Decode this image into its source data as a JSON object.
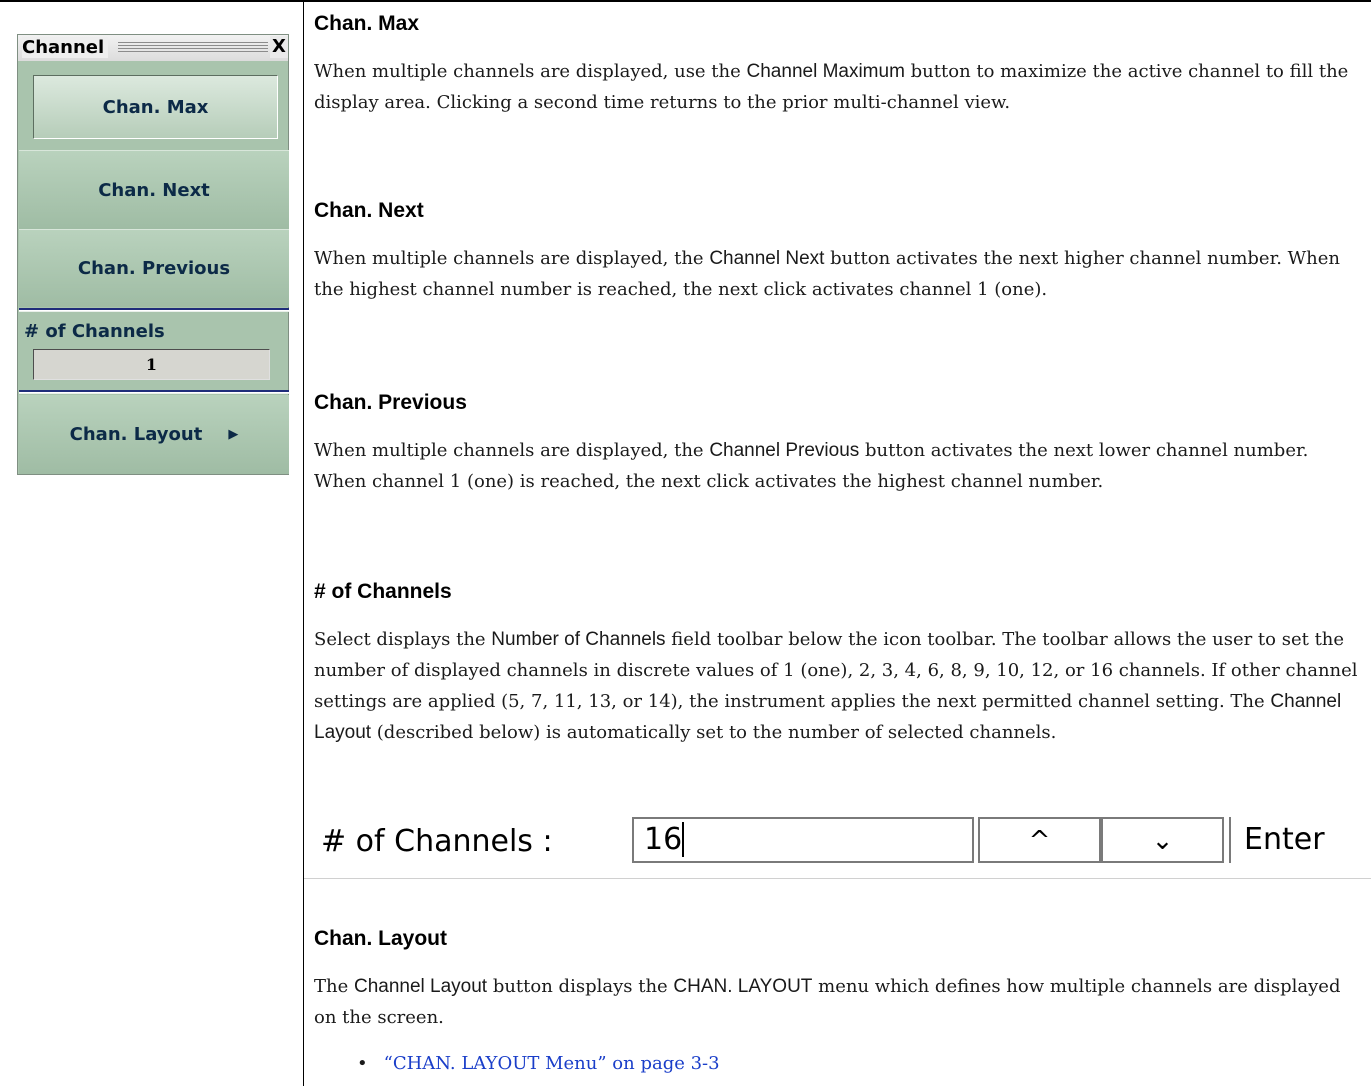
{
  "panel": {
    "title": "Channel",
    "close_label": "X",
    "buttons": {
      "chan_max": "Chan. Max",
      "chan_next": "Chan. Next",
      "chan_previous": "Chan. Previous",
      "chan_layout": "Chan. Layout"
    },
    "num_channels_label": "# of Channels",
    "num_channels_value": "1",
    "arrow_icon": "triangle-right-icon"
  },
  "doc": {
    "sections": [
      {
        "heading": "Chan. Max",
        "p1": "When multiple channels are displayed, use the ",
        "term": "Channel Maximum",
        "p2": " button to maximize the active channel to fill the display area. Clicking a second time returns to the prior multi-channel view."
      },
      {
        "heading": "Chan. Next",
        "p1": "When multiple channels are displayed, the ",
        "term": "Channel Next",
        "p2": " button activates the next higher channel number. When the highest channel number is reached, the next click activates channel 1 (one)."
      },
      {
        "heading": "Chan. Previous",
        "p1": "When multiple channels are displayed, the ",
        "term": "Channel Previous",
        "p2": " button activates the next lower channel number. When channel 1 (one) is reached, the next click activates the highest channel number."
      },
      {
        "heading": "# of Channels",
        "p1": "Select displays the ",
        "term": "Number of Channels",
        "p2": " field toolbar below the icon toolbar. The toolbar allows the user to set the number of displayed channels in discrete values of 1 (one), 2, 3, 4, 6, 8, 9, 10, 12, or 16 channels. If other channel settings are applied (5, 7, 11, 13, or 14), the instrument applies the next permitted channel setting. The ",
        "term2": "Channel Layout",
        "p3": " (described below) is automatically set to the number of selected channels."
      },
      {
        "heading": "Chan. Layout",
        "p1": "The ",
        "term": "Channel Layout",
        "p2": " button displays the ",
        "term2": "CHAN. LAYOUT",
        "p3": " menu which defines how multiple channels are displayed on the screen."
      }
    ],
    "toolbar": {
      "label": "# of Channels :",
      "value": "16",
      "up_glyph": "^",
      "down_glyph": "⌄",
      "enter_label": "Enter"
    },
    "link_bullet": "•",
    "link_text": "“CHAN. LAYOUT Menu” on page 3-3"
  }
}
